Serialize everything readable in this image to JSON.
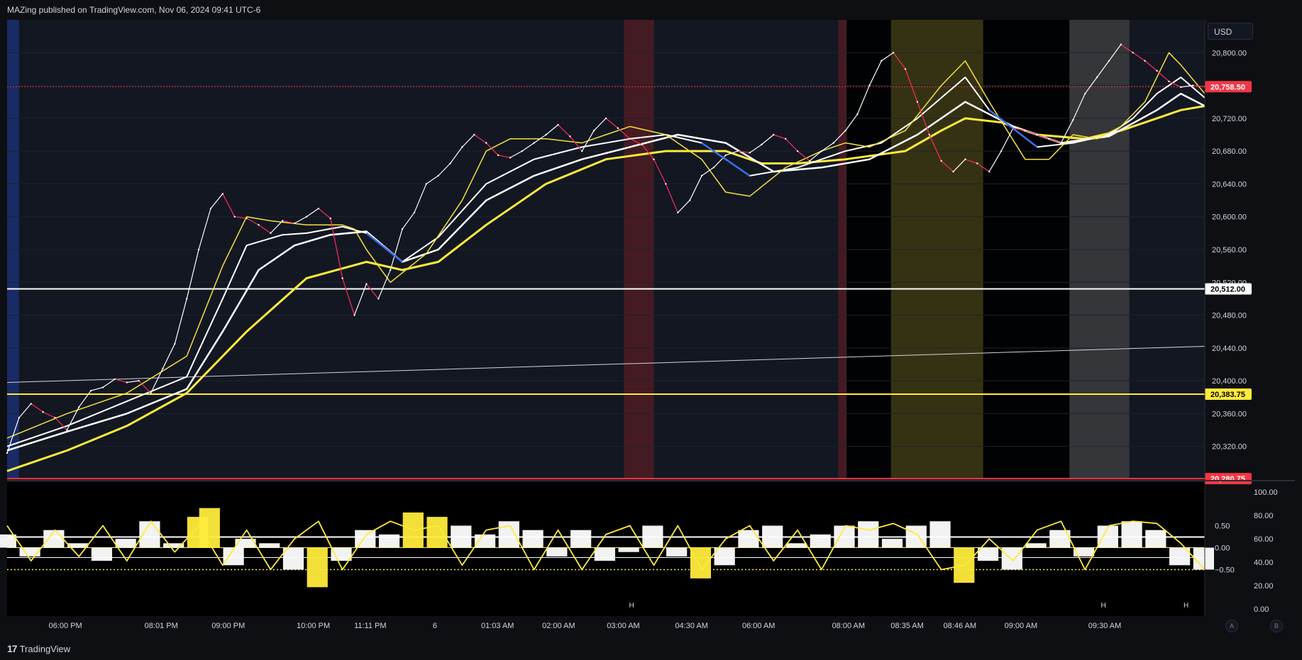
{
  "header": {
    "publish_text": "MAZing published on TradingView.com, Nov 06, 2024 09:41 UTC-6"
  },
  "footer": {
    "brand": "TradingView",
    "logo_glyph": "17"
  },
  "currency": "USD",
  "corner_buttons": [
    "A",
    "B"
  ],
  "colors": {
    "background": "#131722",
    "price_up": "#ffffff",
    "price_down": "#ff2d55",
    "ma_fast": "#f5e23a",
    "ma_slow_yellow": "#ffeb3b",
    "ma_blue": "#3a6df0",
    "ma_white": "#ffffff",
    "red_zone": "#4a1c22",
    "olive_zone": "#3a3512",
    "grey_zone": "#3a3a3c",
    "black_zone": "#000000",
    "blue_zone": "#1b2d6b",
    "osc_yellow": "#ffeb3b"
  },
  "chart_data": [
    {
      "type": "line",
      "title": "",
      "ylim": [
        20280,
        20840
      ],
      "y_ticks": [
        "20,800.00",
        "20,760.00",
        "20,720.00",
        "20,680.00",
        "20,640.00",
        "20,600.00",
        "20,560.00",
        "20,520.00",
        "20,480.00",
        "20,440.00",
        "20,400.00",
        "20,360.00",
        "20,320.00"
      ],
      "y_tick_values": [
        20800,
        20760,
        20720,
        20680,
        20640,
        20600,
        20560,
        20520,
        20480,
        20440,
        20400,
        20360,
        20320
      ],
      "x_ticks": [
        "06:00 PM",
        "08:01 PM",
        "09:00 PM",
        "10:00 PM",
        "11:11 PM",
        "6",
        "01:03 AM",
        "02:00 AM",
        "03:00 AM",
        "04:30 AM",
        "06:00 AM",
        "08:00 AM",
        "08:35 AM",
        "08:46 AM",
        "09:00 AM",
        "09:30 AM"
      ],
      "x_tick_positions": [
        0.048,
        0.128,
        0.184,
        0.255,
        0.303,
        0.357,
        0.409,
        0.46,
        0.514,
        0.571,
        0.627,
        0.702,
        0.751,
        0.795,
        0.846,
        0.916
      ],
      "price_labels": [
        {
          "text": "20,758.50",
          "value": 20758.5,
          "bg": "#f23645",
          "fg": "#ffffff"
        },
        {
          "text": "20,512.00",
          "value": 20512,
          "bg": "#ffffff",
          "fg": "#000000"
        },
        {
          "text": "20,383.75",
          "value": 20383.75,
          "bg": "#ffeb3b",
          "fg": "#000000"
        },
        {
          "text": "20,280.75",
          "value": 20280.75,
          "bg": "#f23645",
          "fg": "#ffffff"
        }
      ],
      "series": [
        {
          "name": "",
          "role": "price",
          "x": [
            0,
            0.01,
            0.02,
            0.03,
            0.04,
            0.05,
            0.06,
            0.07,
            0.08,
            0.09,
            0.1,
            0.11,
            0.12,
            0.13,
            0.14,
            0.15,
            0.16,
            0.17,
            0.18,
            0.19,
            0.2,
            0.21,
            0.22,
            0.23,
            0.24,
            0.25,
            0.26,
            0.27,
            0.28,
            0.29,
            0.3,
            0.31,
            0.32,
            0.33,
            0.34,
            0.35,
            0.36,
            0.37,
            0.38,
            0.39,
            0.4,
            0.41,
            0.42,
            0.43,
            0.44,
            0.45,
            0.46,
            0.47,
            0.48,
            0.49,
            0.5,
            0.51,
            0.52,
            0.53,
            0.54,
            0.55,
            0.56,
            0.57,
            0.58,
            0.59,
            0.6,
            0.61,
            0.62,
            0.63,
            0.64,
            0.65,
            0.66,
            0.67,
            0.68,
            0.69,
            0.7,
            0.71,
            0.72,
            0.73,
            0.74,
            0.75,
            0.76,
            0.77,
            0.78,
            0.79,
            0.8,
            0.81,
            0.82,
            0.83,
            0.84,
            0.85,
            0.86,
            0.87,
            0.88,
            0.89,
            0.9,
            0.91,
            0.92,
            0.93,
            0.94,
            0.95,
            0.96,
            0.97,
            0.98,
            0.99,
            1.0
          ],
          "values": [
            20312,
            20355,
            20372,
            20362,
            20355,
            20340,
            20368,
            20388,
            20392,
            20402,
            20398,
            20400,
            20385,
            20415,
            20445,
            20500,
            20560,
            20610,
            20628,
            20600,
            20598,
            20590,
            20580,
            20595,
            20592,
            20600,
            20610,
            20598,
            20525,
            20480,
            20518,
            20500,
            20535,
            20585,
            20605,
            20640,
            20650,
            20665,
            20685,
            20700,
            20690,
            20675,
            20672,
            20680,
            20690,
            20700,
            20712,
            20698,
            20680,
            20705,
            20720,
            20708,
            20695,
            20688,
            20670,
            20640,
            20605,
            20620,
            20650,
            20660,
            20675,
            20680,
            20678,
            20688,
            20700,
            20695,
            20680,
            20668,
            20680,
            20690,
            20705,
            20725,
            20760,
            20790,
            20800,
            20780,
            20740,
            20700,
            20668,
            20655,
            20670,
            20665,
            20655,
            20680,
            20708,
            20705,
            20700,
            20695,
            20690,
            20718,
            20750,
            20770,
            20790,
            20810,
            20800,
            20790,
            20778,
            20765,
            20758,
            20760,
            20758.5
          ]
        },
        {
          "name": "",
          "role": "ma_fast",
          "x": [
            0,
            0.05,
            0.1,
            0.15,
            0.18,
            0.2,
            0.22,
            0.25,
            0.28,
            0.29,
            0.3,
            0.32,
            0.35,
            0.38,
            0.4,
            0.42,
            0.45,
            0.48,
            0.5,
            0.52,
            0.55,
            0.58,
            0.6,
            0.62,
            0.65,
            0.68,
            0.7,
            0.72,
            0.75,
            0.78,
            0.8,
            0.82,
            0.85,
            0.87,
            0.89,
            0.91,
            0.93,
            0.95,
            0.97,
            0.98,
            1.0
          ],
          "values": [
            20330,
            20360,
            20385,
            20430,
            20540,
            20600,
            20595,
            20590,
            20590,
            20585,
            20560,
            20520,
            20555,
            20620,
            20680,
            20695,
            20695,
            20690,
            20700,
            20710,
            20700,
            20670,
            20630,
            20625,
            20660,
            20680,
            20690,
            20685,
            20705,
            20760,
            20790,
            20740,
            20670,
            20670,
            20700,
            20695,
            20710,
            20740,
            20800,
            20785,
            20750
          ]
        },
        {
          "name": "",
          "role": "ma_white1",
          "x": [
            0,
            0.05,
            0.1,
            0.15,
            0.18,
            0.2,
            0.23,
            0.25,
            0.28,
            0.3,
            0.33,
            0.36,
            0.4,
            0.44,
            0.48,
            0.52,
            0.55,
            0.58,
            0.62,
            0.66,
            0.7,
            0.73,
            0.76,
            0.8,
            0.82,
            0.86,
            0.89,
            0.92,
            0.94,
            0.96,
            0.98,
            1.0
          ],
          "values": [
            20320,
            20345,
            20375,
            20405,
            20500,
            20565,
            20578,
            20580,
            20588,
            20580,
            20545,
            20575,
            20640,
            20670,
            20685,
            20695,
            20700,
            20690,
            20650,
            20660,
            20680,
            20690,
            20720,
            20770,
            20730,
            20685,
            20690,
            20700,
            20720,
            20750,
            20770,
            20745
          ]
        },
        {
          "name": "",
          "role": "ma_white2",
          "x": [
            0,
            0.05,
            0.1,
            0.15,
            0.18,
            0.21,
            0.24,
            0.27,
            0.3,
            0.33,
            0.36,
            0.4,
            0.44,
            0.48,
            0.52,
            0.56,
            0.6,
            0.64,
            0.68,
            0.72,
            0.76,
            0.8,
            0.84,
            0.88,
            0.92,
            0.96,
            0.98,
            1.0
          ],
          "values": [
            20315,
            20338,
            20360,
            20390,
            20460,
            20535,
            20565,
            20578,
            20582,
            20545,
            20560,
            20620,
            20650,
            20670,
            20685,
            20700,
            20690,
            20655,
            20660,
            20670,
            20700,
            20740,
            20710,
            20690,
            20698,
            20730,
            20750,
            20735
          ]
        },
        {
          "name": "",
          "role": "ma_slow",
          "x": [
            0,
            0.05,
            0.1,
            0.15,
            0.2,
            0.25,
            0.3,
            0.33,
            0.36,
            0.4,
            0.45,
            0.5,
            0.55,
            0.6,
            0.63,
            0.66,
            0.7,
            0.75,
            0.78,
            0.8,
            0.83,
            0.86,
            0.9,
            0.93,
            0.96,
            0.98,
            1.0
          ],
          "values": [
            20290,
            20315,
            20345,
            20385,
            20460,
            20525,
            20545,
            20535,
            20545,
            20590,
            20640,
            20670,
            20680,
            20680,
            20665,
            20665,
            20670,
            20680,
            20705,
            20720,
            20715,
            20700,
            20695,
            20705,
            20720,
            20730,
            20735
          ]
        },
        {
          "name": "",
          "role": "trendline",
          "x": [
            0,
            1
          ],
          "values": [
            20398,
            20442
          ]
        }
      ],
      "shaded_zones": [
        {
          "from": 0.0,
          "to": 0.01,
          "color": "blue_zone"
        },
        {
          "from": 0.515,
          "to": 0.54,
          "color": "red_zone"
        },
        {
          "from": 0.694,
          "to": 0.701,
          "color": "red_zone"
        },
        {
          "from": 0.701,
          "to": 0.738,
          "color": "black_zone"
        },
        {
          "from": 0.738,
          "to": 0.815,
          "color": "olive_zone"
        },
        {
          "from": 0.815,
          "to": 0.887,
          "color": "black_zone"
        },
        {
          "from": 0.887,
          "to": 0.937,
          "color": "grey_zone"
        }
      ]
    },
    {
      "type": "area",
      "title": "",
      "ylim": [
        0,
        100
      ],
      "y_ticks_right": [
        "100.00",
        "80.00",
        "60.00",
        "40.00",
        "20.00",
        "0.00"
      ],
      "y_ticks_right_values": [
        100,
        80,
        60,
        40,
        20,
        0
      ],
      "y_ticks_inner": [
        "0.50",
        "0.00",
        "−0.50"
      ],
      "y_ticks_inner_values": [
        0.5,
        0,
        -0.5
      ],
      "h_markers": [
        {
          "text": "H",
          "x": 0.521
        },
        {
          "text": "H",
          "x": 0.915
        },
        {
          "text": "H",
          "x": 0.984
        }
      ],
      "series": [
        {
          "name": "",
          "role": "histogram",
          "x": [
            0,
            0.02,
            0.04,
            0.06,
            0.08,
            0.1,
            0.12,
            0.14,
            0.16,
            0.17,
            0.19,
            0.2,
            0.22,
            0.24,
            0.26,
            0.28,
            0.3,
            0.32,
            0.34,
            0.36,
            0.38,
            0.4,
            0.42,
            0.44,
            0.46,
            0.48,
            0.5,
            0.52,
            0.54,
            0.56,
            0.58,
            0.6,
            0.62,
            0.64,
            0.66,
            0.68,
            0.7,
            0.72,
            0.74,
            0.76,
            0.78,
            0.8,
            0.82,
            0.84,
            0.86,
            0.88,
            0.9,
            0.92,
            0.94,
            0.96,
            0.98,
            1.0
          ],
          "values": [
            0.3,
            -0.2,
            0.4,
            0.1,
            -0.3,
            0.2,
            0.6,
            0.1,
            0.7,
            0.9,
            -0.4,
            0.2,
            0.1,
            -0.5,
            -0.9,
            -0.3,
            0.4,
            0.3,
            0.8,
            0.7,
            0.5,
            0.3,
            0.6,
            0.4,
            -0.2,
            0.4,
            -0.3,
            -0.1,
            0.5,
            -0.2,
            -0.7,
            -0.4,
            0.4,
            0.5,
            0.1,
            0.3,
            0.5,
            0.6,
            0.2,
            0.5,
            0.6,
            -0.8,
            -0.3,
            -0.5,
            0.1,
            0.4,
            -0.2,
            0.5,
            0.6,
            0.4,
            -0.4,
            -0.5
          ]
        },
        {
          "name": "",
          "role": "signal",
          "x": [
            0,
            0.02,
            0.04,
            0.06,
            0.08,
            0.1,
            0.12,
            0.14,
            0.16,
            0.18,
            0.2,
            0.22,
            0.24,
            0.26,
            0.28,
            0.3,
            0.32,
            0.34,
            0.36,
            0.38,
            0.4,
            0.42,
            0.44,
            0.46,
            0.48,
            0.5,
            0.52,
            0.54,
            0.56,
            0.58,
            0.6,
            0.62,
            0.64,
            0.66,
            0.68,
            0.7,
            0.72,
            0.74,
            0.76,
            0.78,
            0.8,
            0.82,
            0.84,
            0.86,
            0.88,
            0.9,
            0.92,
            0.94,
            0.96,
            0.98,
            1.0
          ],
          "values": [
            0.5,
            -0.3,
            0.4,
            -0.2,
            0.5,
            -0.3,
            0.6,
            -0.1,
            0.5,
            -0.4,
            0.4,
            -0.5,
            0.2,
            0.6,
            -0.5,
            0.3,
            0.6,
            0.4,
            0.5,
            -0.4,
            0.4,
            0.5,
            -0.5,
            0.4,
            -0.5,
            0.3,
            0.5,
            -0.4,
            0.5,
            -0.5,
            0.2,
            0.5,
            -0.3,
            0.4,
            -0.5,
            0.5,
            0.4,
            0.55,
            0.3,
            -0.5,
            -0.4,
            0.2,
            -0.3,
            0.4,
            0.6,
            -0.5,
            0.5,
            0.6,
            0.55,
            0.1,
            -0.5
          ]
        }
      ]
    }
  ]
}
